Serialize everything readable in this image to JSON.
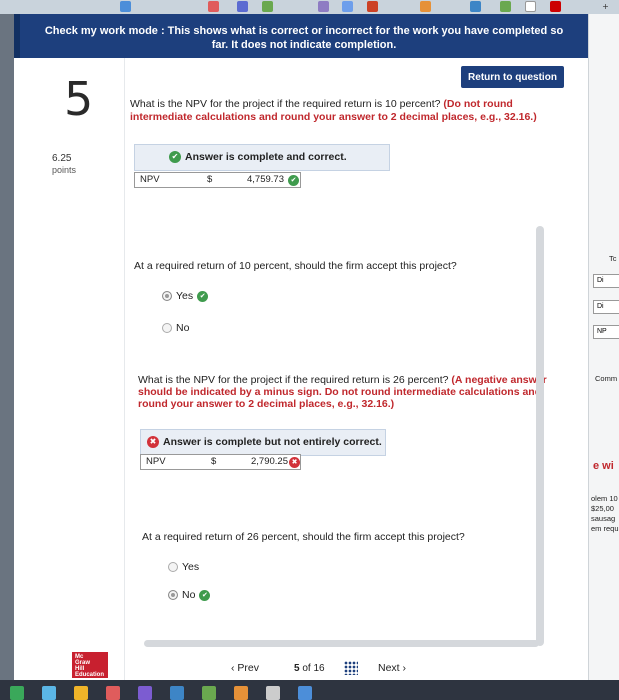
{
  "banner": {
    "line1": "Check my work mode : This shows what is correct or incorrect for the work you have completed so",
    "line2": "far. It does not indicate completion."
  },
  "return_button": "Return to question",
  "question": {
    "number": "5",
    "points_value": "6.25",
    "points_label": "points",
    "q1_text": "What is the NPV for the project if the required return is 10 percent?",
    "q1_instructions": "(Do not round intermediate calculations and round your answer to 2 decimal places, e.g., 32.16.)",
    "q1_status": "Answer is complete and correct.",
    "q1_row": {
      "label": "NPV",
      "currency": "$",
      "value": "4,759.73"
    },
    "q2_prompt": "At a required return of 10 percent, should the firm accept this project?",
    "q2_options": [
      "Yes",
      "No"
    ],
    "q3_text": "What is the NPV for the project if the required return is 26 percent?",
    "q3_instructions": "(A negative answer should be indicated by a minus sign. Do not round intermediate calculations and round your answer to 2 decimal places, e.g., 32.16.)",
    "q3_status": "Answer is complete but not entirely correct.",
    "q3_row": {
      "label": "NPV",
      "currency": "$",
      "value": "2,790.25"
    },
    "q4_prompt": "At a required return of 26 percent, should the firm accept this project?",
    "q4_options": [
      "Yes",
      "No"
    ]
  },
  "nav": {
    "logo_lines": [
      "Mc",
      "Graw",
      "Hill",
      "Education"
    ],
    "prev": "Prev",
    "page_current": "5",
    "page_of": "of",
    "page_total": "16",
    "next": "Next"
  },
  "side": {
    "texts": [
      "Tc",
      "Di",
      "Di",
      "NP",
      "Comm",
      "e wi",
      "olem 10",
      "$25,00",
      "sausag",
      "em requ"
    ]
  },
  "colors": {
    "banner": "#1d3f7d",
    "correct": "#3f9b4d",
    "incorrect": "#d2323a",
    "emphasis": "#c0282d"
  }
}
